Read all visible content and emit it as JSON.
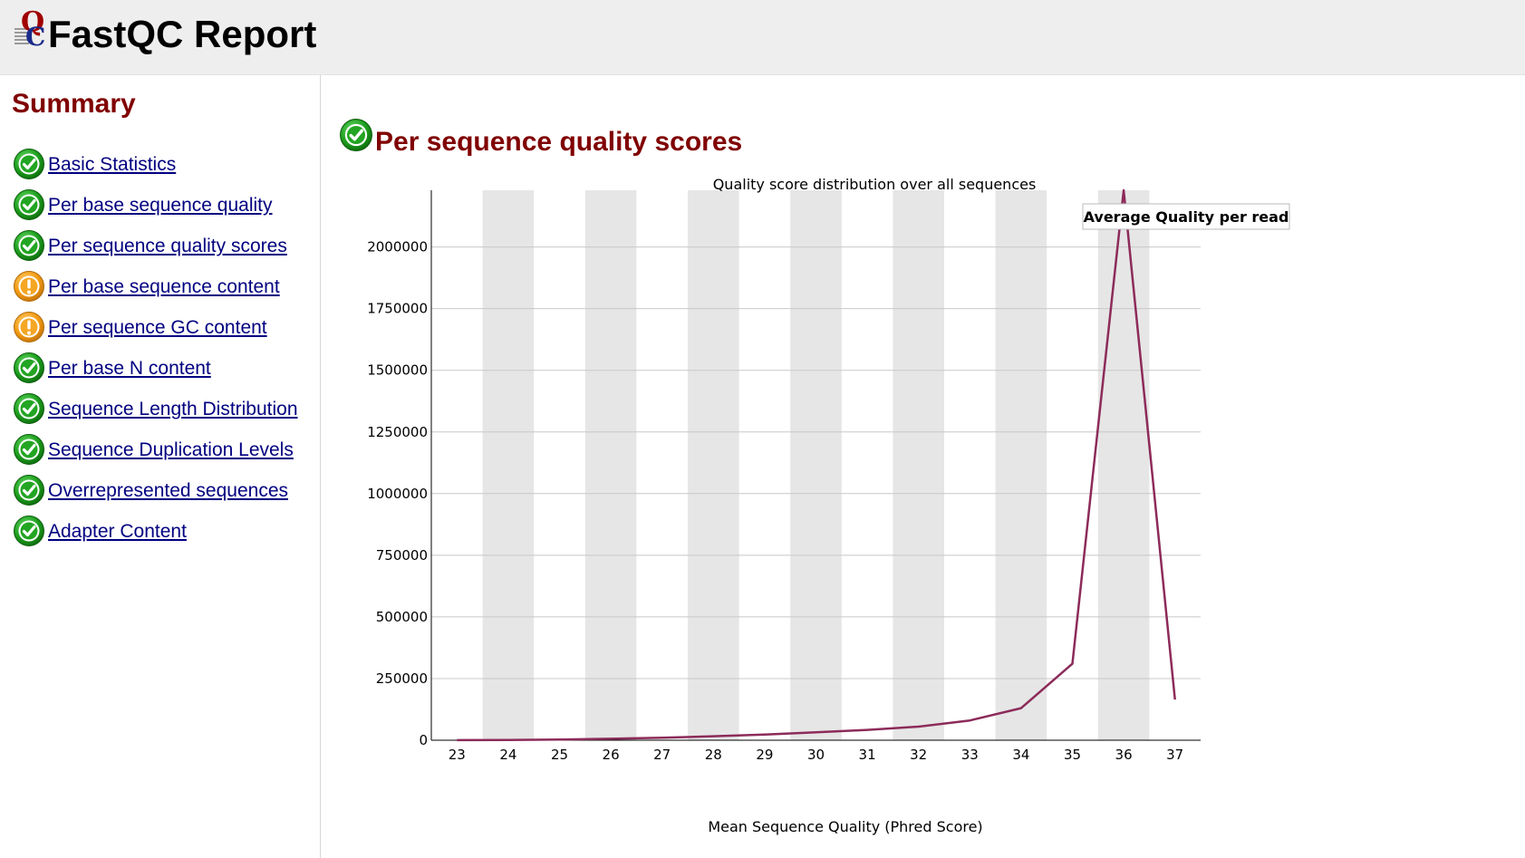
{
  "header": {
    "title": "FastQC Report",
    "logo_icon": "fastqc-logo-icon"
  },
  "summary": {
    "title": "Summary",
    "items": [
      {
        "label": "Basic Statistics",
        "status": "pass"
      },
      {
        "label": "Per base sequence quality",
        "status": "pass"
      },
      {
        "label": "Per sequence quality scores",
        "status": "pass"
      },
      {
        "label": "Per base sequence content",
        "status": "warn"
      },
      {
        "label": "Per sequence GC content",
        "status": "warn"
      },
      {
        "label": "Per base N content",
        "status": "pass"
      },
      {
        "label": "Sequence Length Distribution",
        "status": "pass"
      },
      {
        "label": "Sequence Duplication Levels",
        "status": "pass"
      },
      {
        "label": "Overrepresented sequences",
        "status": "pass"
      },
      {
        "label": "Adapter Content",
        "status": "pass"
      }
    ]
  },
  "module": {
    "title": "Per sequence quality scores",
    "status": "pass"
  },
  "colors": {
    "pass": "#1e9e1e",
    "warn": "#f39c12",
    "series": "#8c2b5a",
    "band": "#e6e6e6",
    "heading": "#800000",
    "link": "#000080"
  },
  "chart_data": {
    "type": "line",
    "title": "Quality score distribution over all sequences",
    "xlabel": "Mean Sequence Quality (Phred Score)",
    "ylabel": "",
    "x": [
      23,
      24,
      25,
      26,
      27,
      28,
      29,
      30,
      31,
      32,
      33,
      34,
      35,
      36,
      37
    ],
    "yticks": [
      0,
      250000,
      500000,
      750000,
      1000000,
      1250000,
      1500000,
      1750000,
      2000000
    ],
    "ylim": [
      0,
      2230000
    ],
    "grid": true,
    "legend_position": "top-right",
    "series": [
      {
        "name": "Average Quality per read",
        "values": [
          200,
          1000,
          3000,
          6000,
          10000,
          16000,
          23000,
          32000,
          42000,
          55000,
          80000,
          130000,
          310000,
          2230000,
          165000
        ]
      }
    ]
  }
}
